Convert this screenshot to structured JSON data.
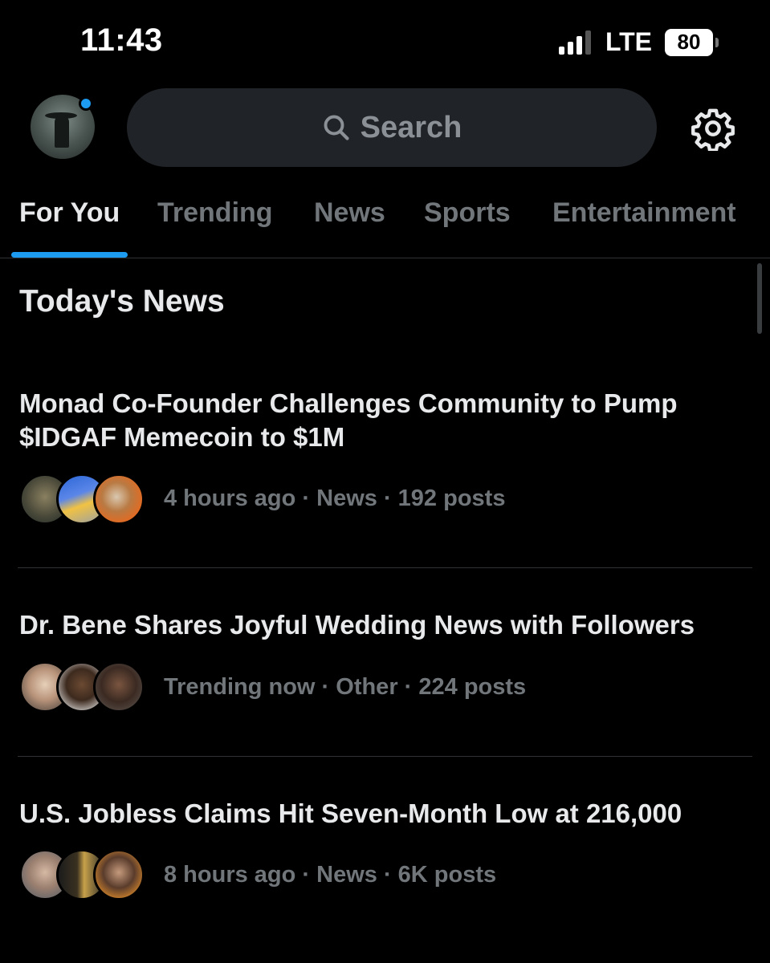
{
  "status_bar": {
    "time": "11:43",
    "network": "LTE",
    "battery": "80"
  },
  "header": {
    "search_placeholder": "Search",
    "icons": [
      "search-icon",
      "gear-icon"
    ]
  },
  "tabs": [
    {
      "label": "For You",
      "active": true
    },
    {
      "label": "Trending",
      "active": false
    },
    {
      "label": "News",
      "active": false
    },
    {
      "label": "Sports",
      "active": false
    },
    {
      "label": "Entertainment",
      "active": false
    }
  ],
  "section": {
    "title": "Today's News"
  },
  "stories": [
    {
      "title": "Monad Co-Founder Challenges Community to Pump $IDGAF Memecoin to $1M",
      "meta": "4 hours ago · News · 192 posts"
    },
    {
      "title": "Dr. Bene Shares Joyful Wedding News with Followers",
      "meta": "Trending now · Other · 224 posts"
    },
    {
      "title": "U.S. Jobless Claims Hit Seven-Month Low at 216,000",
      "meta": "8 hours ago · News · 6K posts"
    }
  ],
  "colors": {
    "accent": "#1d9bf0",
    "background": "#000000",
    "text_primary": "#e7e9ea",
    "text_secondary": "#71767b"
  }
}
